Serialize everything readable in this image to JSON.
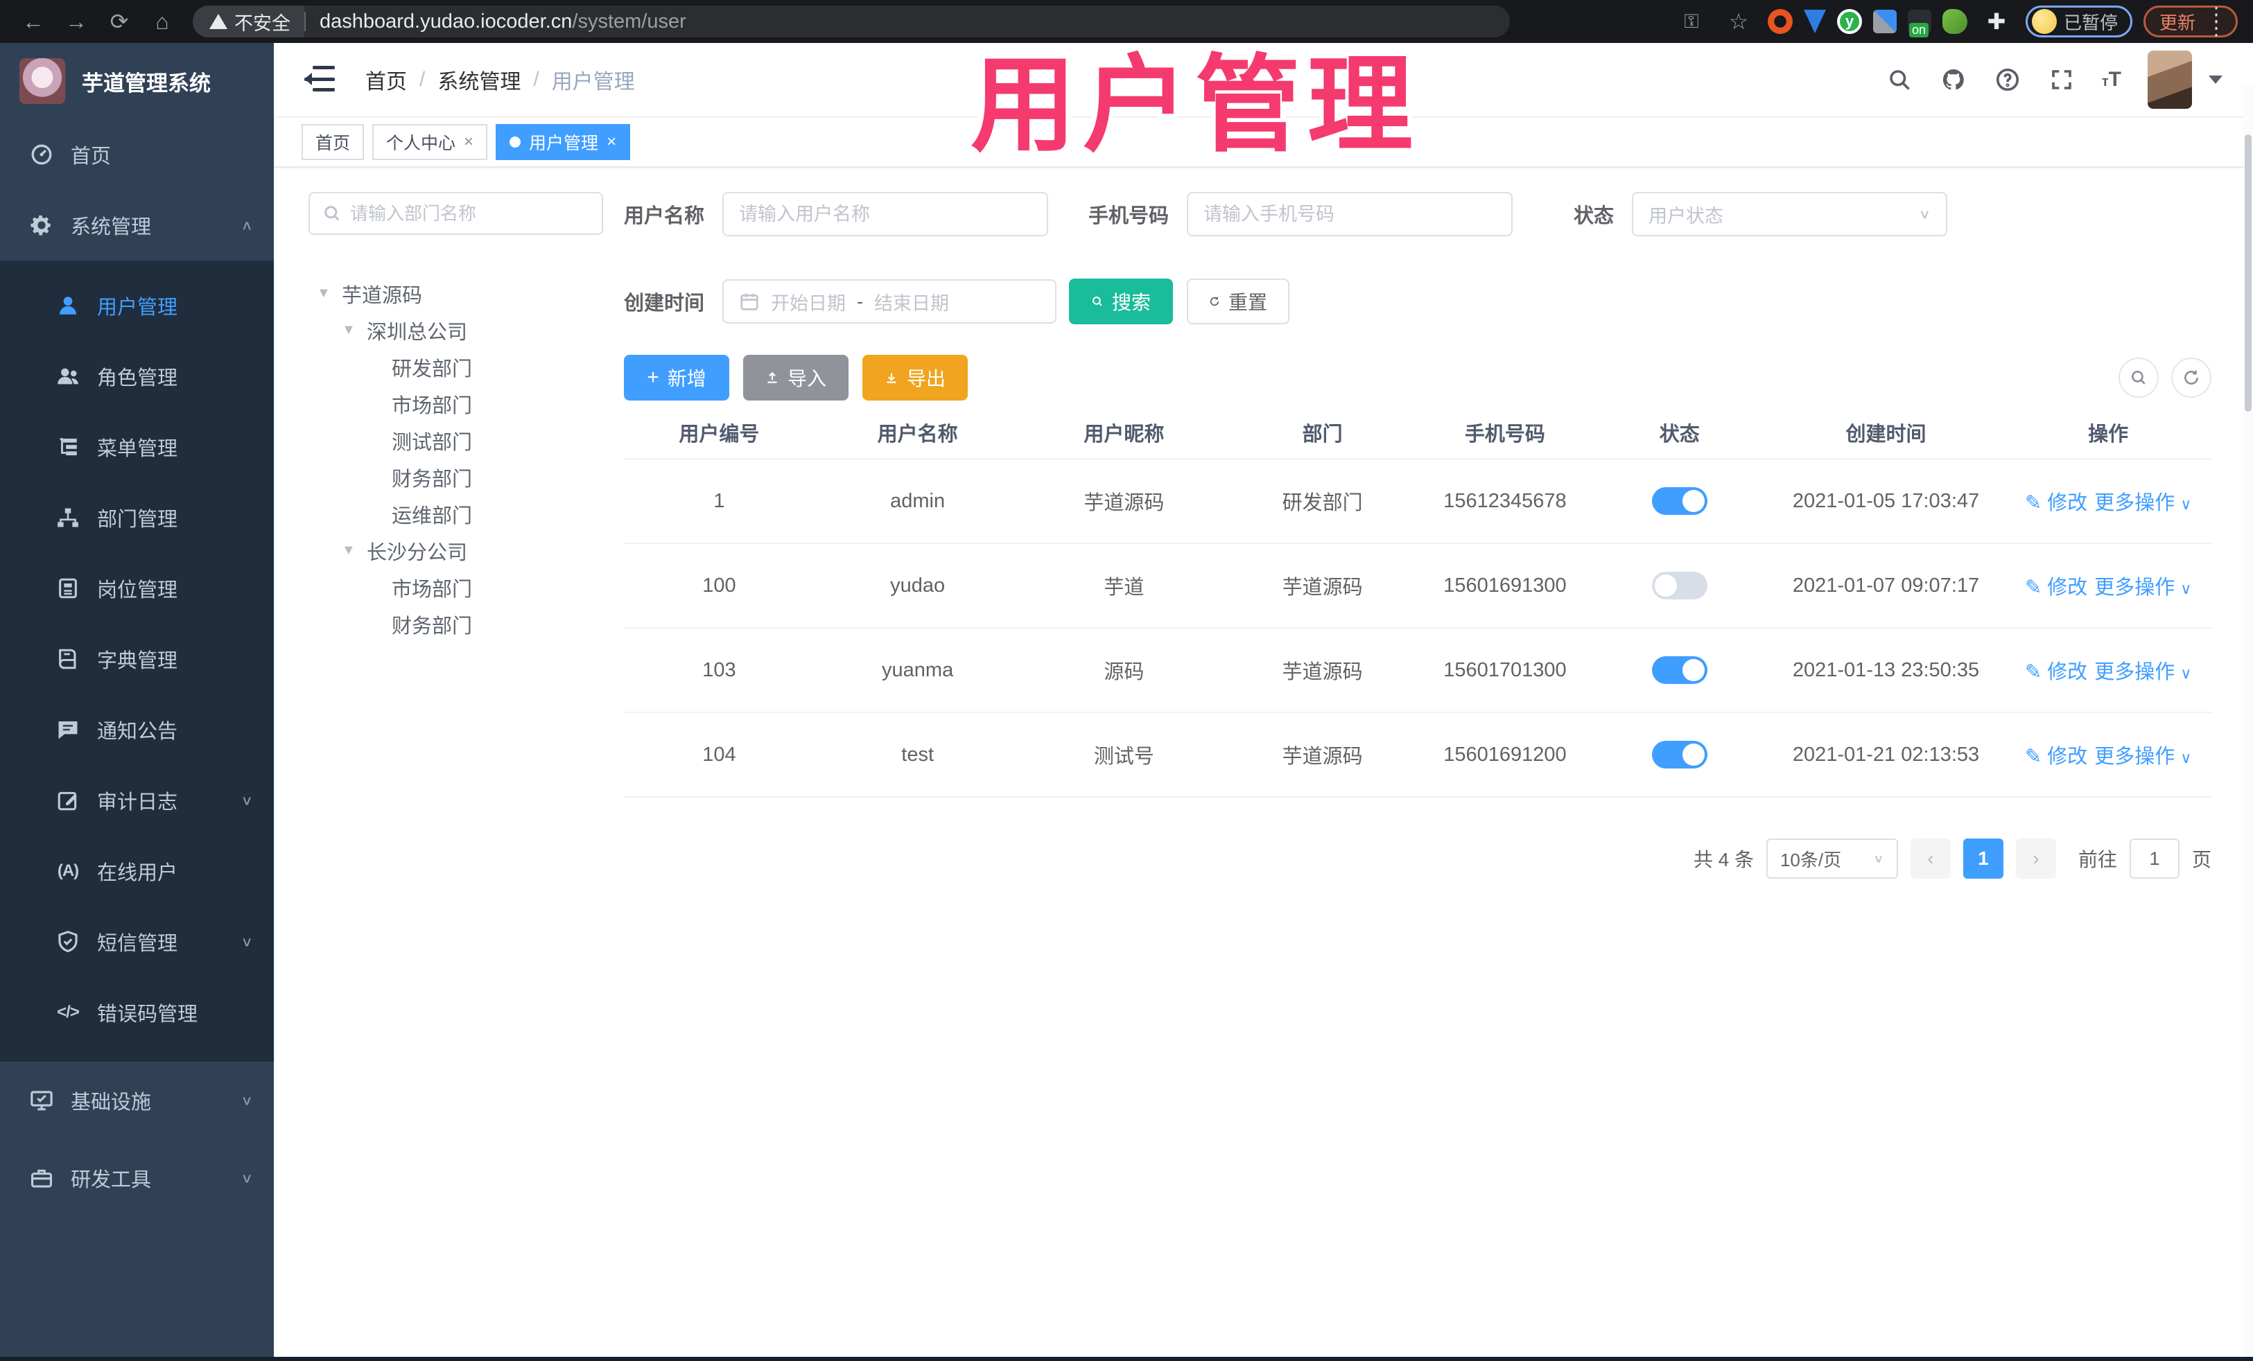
{
  "browser": {
    "security_label": "不安全",
    "url_domain": "dashboard.yudao.iocoder.cn",
    "url_path": "/system/user",
    "profile_status_badge": "已暂停",
    "update_button": "更新",
    "extension_on_badge": "on"
  },
  "overlay": {
    "title": "用户管理"
  },
  "colors": {
    "accent": "#409eff",
    "sidebar_bg": "#304156",
    "submenu_bg": "#1f2d3d",
    "search_button": "#1abc9c",
    "import_button": "#909399",
    "export_button": "#f0a41f",
    "annotation_pink": "#f43a6e"
  },
  "sidebar": {
    "app_title": "芋道管理系统",
    "home": "首页",
    "system": "系统管理",
    "sub": [
      "用户管理",
      "角色管理",
      "菜单管理",
      "部门管理",
      "岗位管理",
      "字典管理",
      "通知公告",
      "审计日志",
      "在线用户",
      "短信管理",
      "错误码管理"
    ],
    "bottom": [
      "基础设施",
      "研发工具"
    ]
  },
  "header": {
    "breadcrumb": [
      "首页",
      "系统管理",
      "用户管理"
    ]
  },
  "tabs": {
    "items": [
      {
        "label": "首页"
      },
      {
        "label": "个人中心"
      },
      {
        "label": "用户管理"
      }
    ],
    "close_glyph": "×"
  },
  "dept": {
    "search_placeholder": "请输入部门名称",
    "nodes": [
      "芋道源码",
      "深圳总公司",
      "研发部门",
      "市场部门",
      "测试部门",
      "财务部门",
      "运维部门",
      "长沙分公司",
      "市场部门",
      "财务部门"
    ]
  },
  "filters": {
    "username_label": "用户名称",
    "username_placeholder": "请输入用户名称",
    "mobile_label": "手机号码",
    "mobile_placeholder": "请输入手机号码",
    "status_label": "状态",
    "status_placeholder": "用户状态",
    "time_label": "创建时间",
    "start_placeholder": "开始日期",
    "range_separator": "-",
    "end_placeholder": "结束日期",
    "search_button": "搜索",
    "reset_button": "重置"
  },
  "toolbar": {
    "add": "新增",
    "import": "导入",
    "export": "导出"
  },
  "table": {
    "columns": [
      "用户编号",
      "用户名称",
      "用户昵称",
      "部门",
      "手机号码",
      "状态",
      "创建时间",
      "操作"
    ],
    "actions": {
      "edit": "修改",
      "more": "更多操作"
    },
    "rows": [
      {
        "id": "1",
        "username": "admin",
        "nickname": "芋道源码",
        "dept": "研发部门",
        "mobile": "15612345678",
        "status": "on",
        "created": "2021-01-05 17:03:47"
      },
      {
        "id": "100",
        "username": "yudao",
        "nickname": "芋道",
        "dept": "芋道源码",
        "mobile": "15601691300",
        "status": "off",
        "created": "2021-01-07 09:07:17"
      },
      {
        "id": "103",
        "username": "yuanma",
        "nickname": "源码",
        "dept": "芋道源码",
        "mobile": "15601701300",
        "status": "on",
        "created": "2021-01-13 23:50:35"
      },
      {
        "id": "104",
        "username": "test",
        "nickname": "测试号",
        "dept": "芋道源码",
        "mobile": "15601691200",
        "status": "on",
        "created": "2021-01-21 02:13:53"
      }
    ]
  },
  "pagination": {
    "total": "共 4 条",
    "page_size": "10条/页",
    "current_page": "1",
    "goto_label": "前往",
    "goto_value": "1",
    "page_unit": "页"
  }
}
